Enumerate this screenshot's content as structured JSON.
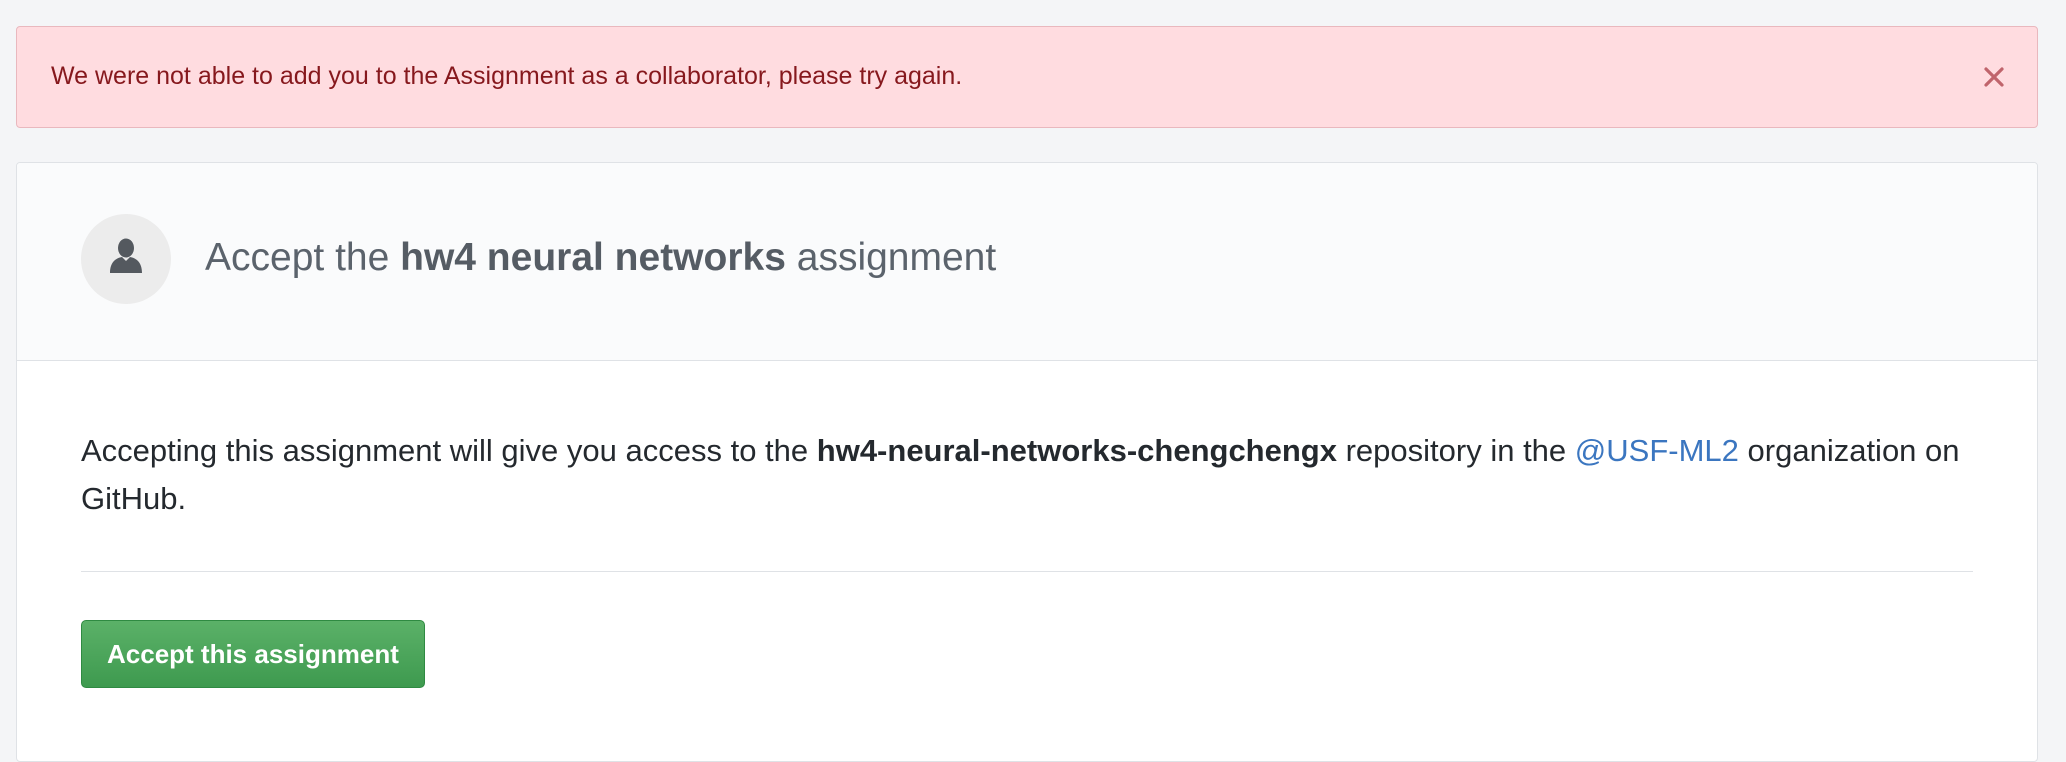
{
  "flash": {
    "message": "We were not able to add you to the Assignment as a collaborator, please try again.",
    "close_icon": "close-icon",
    "colors": {
      "background": "#ffdce0",
      "text": "#86181d"
    }
  },
  "header": {
    "avatar_icon": "person-icon",
    "title_prefix": "Accept the",
    "assignment_name": "hw4 neural networks",
    "title_suffix": "assignment"
  },
  "body": {
    "desc_prefix": "Accepting this assignment will give you access to the",
    "repository_name": "hw4-neural-networks-chengchengx",
    "desc_middle": "repository in the",
    "organization_link": "@USF-ML2",
    "desc_suffix": "organization on GitHub."
  },
  "actions": {
    "accept_label": "Accept this assignment",
    "accent_color": "#3e9a4f"
  }
}
